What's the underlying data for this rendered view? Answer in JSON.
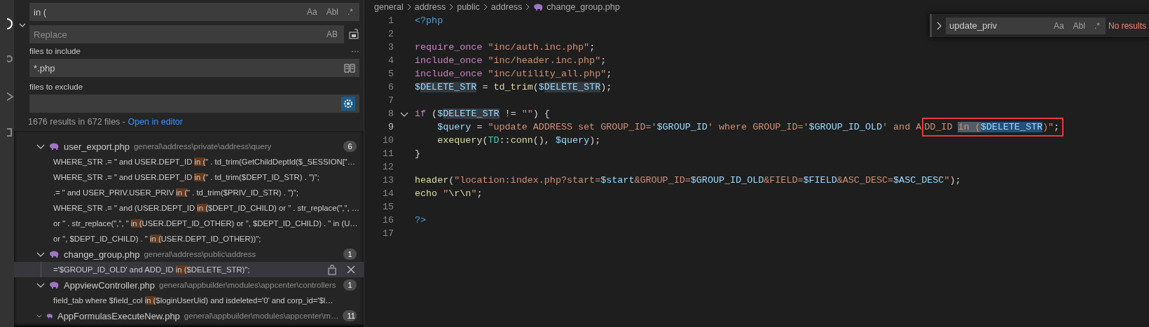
{
  "search": {
    "query": "in (",
    "query_toggles": [
      {
        "label": "Aa",
        "active": false
      },
      {
        "label": "Abl",
        "active": false
      },
      {
        "label": ".*",
        "active": false
      }
    ],
    "replace_placeholder": "Replace",
    "preserve_case": {
      "label": "AB",
      "active": false
    },
    "details_toggle": "···",
    "include_label": "files to include",
    "include_value": "*.php",
    "exclude_label": "files to exclude",
    "use_exclude_settings": true,
    "summary": "1676 results in 672 files - ",
    "open_in_editor": "Open in editor"
  },
  "results": [
    {
      "file": "user_export.php",
      "path": "general\\address\\private\\address\\query",
      "count": "6",
      "expanded": true,
      "matches": [
        {
          "before": "WHERE_STR .= \" and USER.DEPT_ID ",
          "match": "in (",
          "after": "\" . td_trim(GetChildDeptId($_SESSION[\"…",
          "selected": false
        },
        {
          "before": "WHERE_STR .= \" and USER.DEPT_ID ",
          "match": "in (",
          "after": "\" . td_trim($DEPT_ID_STR) . \")\";",
          "selected": false
        },
        {
          "before": ".= \" and USER_PRIV.USER_PRIV ",
          "match": "in (",
          "after": "\" . td_trim($PRIV_ID_STR) . \")\";",
          "selected": false
        },
        {
          "before": "WHERE_STR .= \" and (USER.DEPT_ID ",
          "match": "in (",
          "after": "$DEPT_ID_CHILD) or \" . str_replace(\",\", …",
          "selected": false
        },
        {
          "before": "or \" . str_replace(\",\", \" ",
          "match": "in (",
          "after": "USER.DEPT_ID_OTHER) or \", $DEPT_ID_CHILD) . \" in (U…",
          "selected": false
        },
        {
          "before": "or \", $DEPT_ID_CHILD) . \" ",
          "match": "in (",
          "after": "USER.DEPT_ID_OTHER))\";",
          "selected": false
        }
      ]
    },
    {
      "file": "change_group.php",
      "path": "general\\address\\public\\address",
      "count": "1",
      "expanded": true,
      "matches": [
        {
          "before": "='$GROUP_ID_OLD' and ADD_ID ",
          "match": "in (",
          "after": "$DELETE_STR)\";",
          "selected": true
        }
      ]
    },
    {
      "file": "AppviewController.php",
      "path": "general\\appbuilder\\modules\\appcenter\\controllers",
      "count": "1",
      "expanded": true,
      "matches": [
        {
          "before": "field_tab where $field_col ",
          "match": "in (",
          "after": "$loginUserUid) and isdeleted='0' and corp_id='$l…",
          "selected": false
        }
      ]
    },
    {
      "file": "AppFormulasExecuteNew.php",
      "path": "general\\appbuilder\\modules\\appcenter\\m…",
      "count": "11",
      "expanded": true
    }
  ],
  "breadcrumb": [
    "general",
    "address",
    "public",
    "address",
    "change_group.php"
  ],
  "find_widget": {
    "query": "update_priv",
    "toggles": [
      {
        "label": "Aa",
        "active": false
      },
      {
        "label": "Abl",
        "active": false
      },
      {
        "label": ".*",
        "active": false
      }
    ],
    "status": "No results",
    "replace_expanded": false
  },
  "code": [
    {
      "n": "1",
      "tokens": [
        {
          "t": "<?php",
          "kind": "tag"
        }
      ]
    },
    {
      "n": "2"
    },
    {
      "n": "3",
      "tokens": [
        {
          "t": "require_once",
          "kind": "kw"
        },
        {
          "t": " \"inc/auth.inc.php\"",
          "kind": "str"
        },
        {
          "t": ";",
          "kind": "plain"
        }
      ]
    },
    {
      "n": "4",
      "tokens": [
        {
          "t": "include_once",
          "kind": "kw"
        },
        {
          "t": " \"inc/header.inc.php\"",
          "kind": "str"
        },
        {
          "t": ";",
          "kind": "plain"
        }
      ]
    },
    {
      "n": "5",
      "tokens": [
        {
          "t": "include_once",
          "kind": "kw"
        },
        {
          "t": " \"inc/utility_all.php\"",
          "kind": "str"
        },
        {
          "t": ";",
          "kind": "plain"
        }
      ]
    },
    {
      "n": "6",
      "tokens": [
        {
          "t": "$",
          "kind": "var"
        },
        {
          "t": "DELETE_STR",
          "kind": "var",
          "word_highlight": true
        },
        {
          "t": " = ",
          "kind": "plain"
        },
        {
          "t": "td_trim",
          "kind": "fn"
        },
        {
          "t": "(",
          "kind": "plain"
        },
        {
          "t": "$",
          "kind": "var"
        },
        {
          "t": "DELETE_STR",
          "kind": "var",
          "word_highlight": true
        },
        {
          "t": ");",
          "kind": "plain"
        }
      ]
    },
    {
      "n": "7"
    },
    {
      "n": "8",
      "folded": false,
      "tokens": [
        {
          "t": "if",
          "kind": "kw"
        },
        {
          "t": " (",
          "kind": "plain"
        },
        {
          "t": "$",
          "kind": "var"
        },
        {
          "t": "DELETE_STR",
          "kind": "var",
          "word_highlight": true
        },
        {
          "t": " != ",
          "kind": "plain"
        },
        {
          "t": "\"\"",
          "kind": "str"
        },
        {
          "t": ") {",
          "kind": "plain"
        }
      ]
    },
    {
      "n": "9",
      "current": true,
      "tokens": [
        {
          "t": "    $query",
          "kind": "var"
        },
        {
          "t": " = ",
          "kind": "plain"
        },
        {
          "t": "\"update ADDRESS set GROUP_ID='",
          "kind": "str"
        },
        {
          "t": "$GROUP_ID",
          "kind": "var"
        },
        {
          "t": "' where GROUP_ID='",
          "kind": "str"
        },
        {
          "t": "$GROUP_ID_OLD",
          "kind": "var"
        },
        {
          "t": "' and A",
          "kind": "str"
        },
        {
          "t": "DD_ID ",
          "kind": "str",
          "boxed": true
        },
        {
          "t": "in (",
          "kind": "str",
          "find_match": true,
          "boxed": true
        },
        {
          "t": "$DELETE_STR",
          "kind": "var",
          "selected": true,
          "boxed": true
        },
        {
          "t": ")\"",
          "kind": "str",
          "boxed": true
        },
        {
          "t": ";",
          "kind": "plain",
          "boxed": true
        }
      ]
    },
    {
      "n": "10",
      "tokens": [
        {
          "t": "    exequery",
          "kind": "fn"
        },
        {
          "t": "(",
          "kind": "plain"
        },
        {
          "t": "TD",
          "kind": "cls"
        },
        {
          "t": "::",
          "kind": "plain"
        },
        {
          "t": "conn",
          "kind": "fn"
        },
        {
          "t": "(), ",
          "kind": "plain"
        },
        {
          "t": "$query",
          "kind": "var"
        },
        {
          "t": ");",
          "kind": "plain"
        }
      ]
    },
    {
      "n": "11",
      "tokens": [
        {
          "t": "}",
          "kind": "plain"
        }
      ]
    },
    {
      "n": "12"
    },
    {
      "n": "13",
      "tokens": [
        {
          "t": "header",
          "kind": "fn"
        },
        {
          "t": "(",
          "kind": "plain"
        },
        {
          "t": "\"location:index.php?start=",
          "kind": "str"
        },
        {
          "t": "$start",
          "kind": "var"
        },
        {
          "t": "&GROUP_ID=",
          "kind": "str"
        },
        {
          "t": "$GROUP_ID_OLD",
          "kind": "var"
        },
        {
          "t": "&FIELD=",
          "kind": "str"
        },
        {
          "t": "$FIELD",
          "kind": "var"
        },
        {
          "t": "&ASC_DESC=",
          "kind": "str"
        },
        {
          "t": "$ASC_DESC",
          "kind": "var"
        },
        {
          "t": "\"",
          "kind": "str"
        },
        {
          "t": ");",
          "kind": "plain"
        }
      ]
    },
    {
      "n": "14",
      "tokens": [
        {
          "t": "echo",
          "kind": "fn"
        },
        {
          "t": " \"",
          "kind": "str"
        },
        {
          "t": "\\r\\n",
          "kind": "fn"
        },
        {
          "t": "\"",
          "kind": "str"
        },
        {
          "t": ";",
          "kind": "plain"
        }
      ]
    },
    {
      "n": "15"
    },
    {
      "n": "16",
      "tokens": [
        {
          "t": "?>",
          "kind": "tag"
        }
      ]
    },
    {
      "n": "17"
    }
  ]
}
